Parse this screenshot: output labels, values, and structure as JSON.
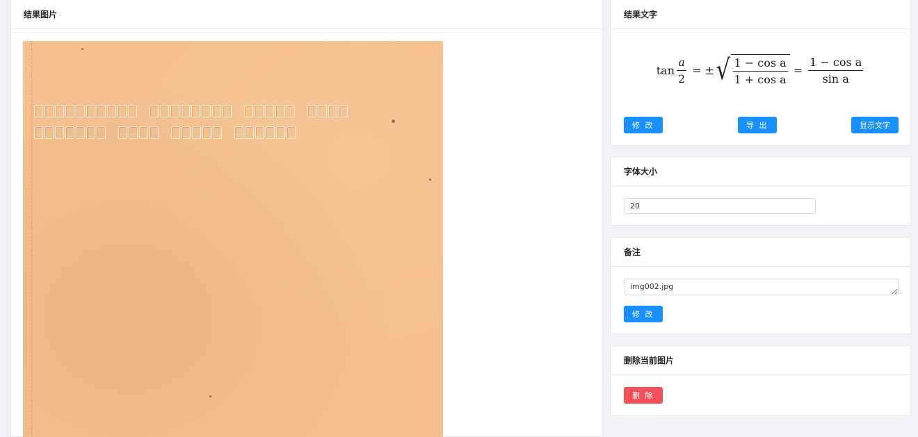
{
  "result_image": {
    "title": "结果图片",
    "image_alt": "braille scan",
    "braille_lines": [
      [
        10,
        8,
        5,
        4
      ],
      [
        7,
        4,
        5,
        6
      ]
    ]
  },
  "result_text": {
    "title": "结果文字",
    "formula": {
      "lhs_func": "tan",
      "lhs_num": "a",
      "lhs_den": "2",
      "eq1": "=",
      "pm": "±",
      "sqrt_num": "1 − cos a",
      "sqrt_den": "1 + cos a",
      "eq2": "=",
      "rhs_num": "1 − cos a",
      "rhs_den": "sin a"
    },
    "buttons": {
      "edit": "修 改",
      "export": "导 出",
      "show_text": "显示文字"
    }
  },
  "font_size": {
    "title": "字体大小",
    "value": "20"
  },
  "remark": {
    "title": "备注",
    "value": "img002.jpg",
    "edit_button": "修 改"
  },
  "delete_image": {
    "title": "删除当前图片",
    "button": "删 除"
  },
  "colors": {
    "primary": "#1890ff",
    "danger": "#f5505a",
    "paper": "#f5c190"
  }
}
